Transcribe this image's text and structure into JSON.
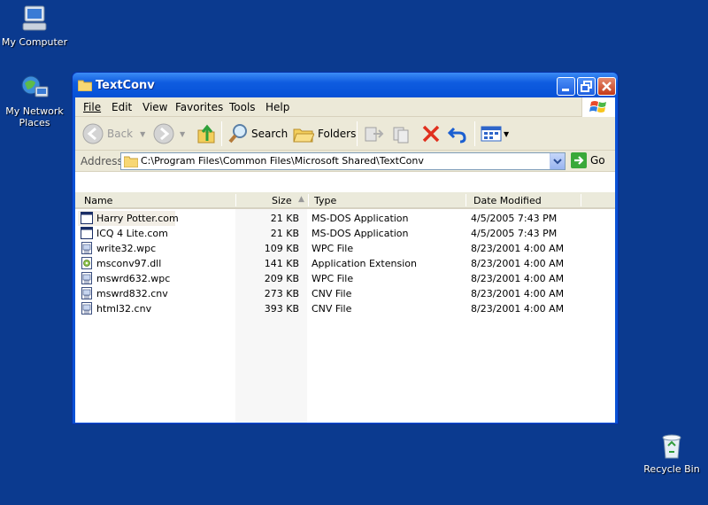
{
  "desktop": {
    "my_computer": "My Computer",
    "network_line1": "My Network",
    "network_line2": "Places",
    "recycle_bin": "Recycle Bin"
  },
  "window": {
    "title": "TextConv",
    "menu": [
      "File",
      "Edit",
      "View",
      "Favorites",
      "Tools",
      "Help"
    ],
    "toolbar": {
      "back": "Back",
      "search": "Search",
      "folders": "Folders"
    },
    "address": {
      "label": "Address",
      "value": "C:\\Program Files\\Common Files\\Microsoft Shared\\TextConv",
      "go": "Go"
    },
    "columns": {
      "name": "Name",
      "size": "Size",
      "type": "Type",
      "date": "Date Modified"
    },
    "files": [
      {
        "name": "Harry Potter.com",
        "size": "21 KB",
        "type": "MS-DOS Application",
        "date": "4/5/2005 7:43 PM",
        "icon": "msdos-app-icon"
      },
      {
        "name": "ICQ 4 Lite.com",
        "size": "21 KB",
        "type": "MS-DOS Application",
        "date": "4/5/2005 7:43 PM",
        "icon": "msdos-app-icon"
      },
      {
        "name": "write32.wpc",
        "size": "109 KB",
        "type": "WPC File",
        "date": "8/23/2001 4:00 AM",
        "icon": "generic-file-icon"
      },
      {
        "name": "msconv97.dll",
        "size": "141 KB",
        "type": "Application Extension",
        "date": "8/23/2001 4:00 AM",
        "icon": "dll-file-icon"
      },
      {
        "name": "mswrd632.wpc",
        "size": "209 KB",
        "type": "WPC File",
        "date": "8/23/2001 4:00 AM",
        "icon": "generic-file-icon"
      },
      {
        "name": "mswrd832.cnv",
        "size": "273 KB",
        "type": "CNV File",
        "date": "8/23/2001 4:00 AM",
        "icon": "generic-file-icon"
      },
      {
        "name": "html32.cnv",
        "size": "393 KB",
        "type": "CNV File",
        "date": "8/23/2001 4:00 AM",
        "icon": "generic-file-icon"
      }
    ]
  },
  "colors": {
    "desktop": "#0B3A8F",
    "titlebar": "#0651D6",
    "chrome": "#ECE9D8"
  }
}
